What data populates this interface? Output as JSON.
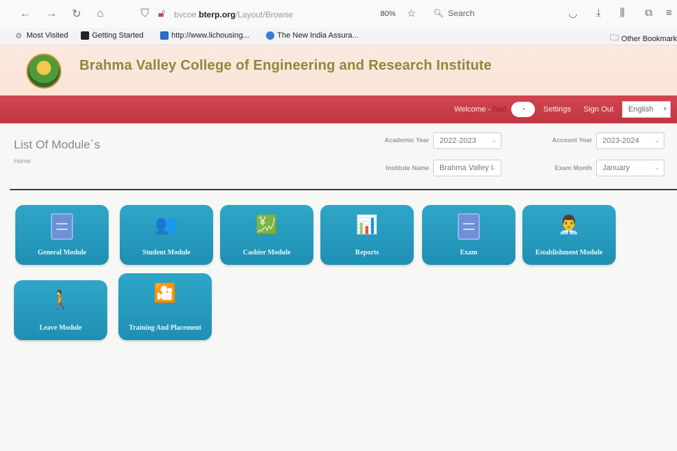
{
  "browser": {
    "url_prefix": "bvcoe.",
    "url_domain": "bterp.org",
    "url_path": "/Layout/Browse",
    "zoom": "80%",
    "search_placeholder": "Search",
    "bookmarks": [
      {
        "label": "Most Visited",
        "icon": "gear-icon"
      },
      {
        "label": "Getting Started",
        "icon": "firefox-icon"
      },
      {
        "label": "http://www.lichousing...",
        "icon": "bookmark-icon"
      },
      {
        "label": "The New India Assura...",
        "icon": "globe-icon"
      }
    ],
    "other_bookmarks": "Other Bookmark"
  },
  "app": {
    "college_name": "Brahma Valley College of Engineering and Research Institute",
    "nav": {
      "welcome_prefix": "Welcome -",
      "welcome_user": "hod",
      "settings": "Settings",
      "sign_out": "Sign Out",
      "language": "English"
    }
  },
  "page": {
    "title": "List Of Module`s",
    "breadcrumb": "Home",
    "filters": {
      "academic_year_label": "Academic Year",
      "academic_year_value": "2022-2023",
      "account_year_label": "Account Year",
      "account_year_value": "2023-2024",
      "institute_name_label": "Institute Name",
      "institute_name_value": "Brahma Valley I",
      "exam_month_label": "Exam Month",
      "exam_month_value": "January"
    }
  },
  "modules": [
    {
      "label": "General Module",
      "icon": "document-icon"
    },
    {
      "label": "Student Module",
      "icon": "students-icon"
    },
    {
      "label": "Cashier Module",
      "icon": "cash-chart-icon"
    },
    {
      "label": "Reports",
      "icon": "report-icon"
    },
    {
      "label": "Exam",
      "icon": "document-icon"
    },
    {
      "label": "Establishment Module",
      "icon": "employee-icon"
    },
    {
      "label": "Leave Module",
      "icon": "walking-person-icon"
    },
    {
      "label": "Training And Placement",
      "icon": "presentation-icon"
    }
  ]
}
